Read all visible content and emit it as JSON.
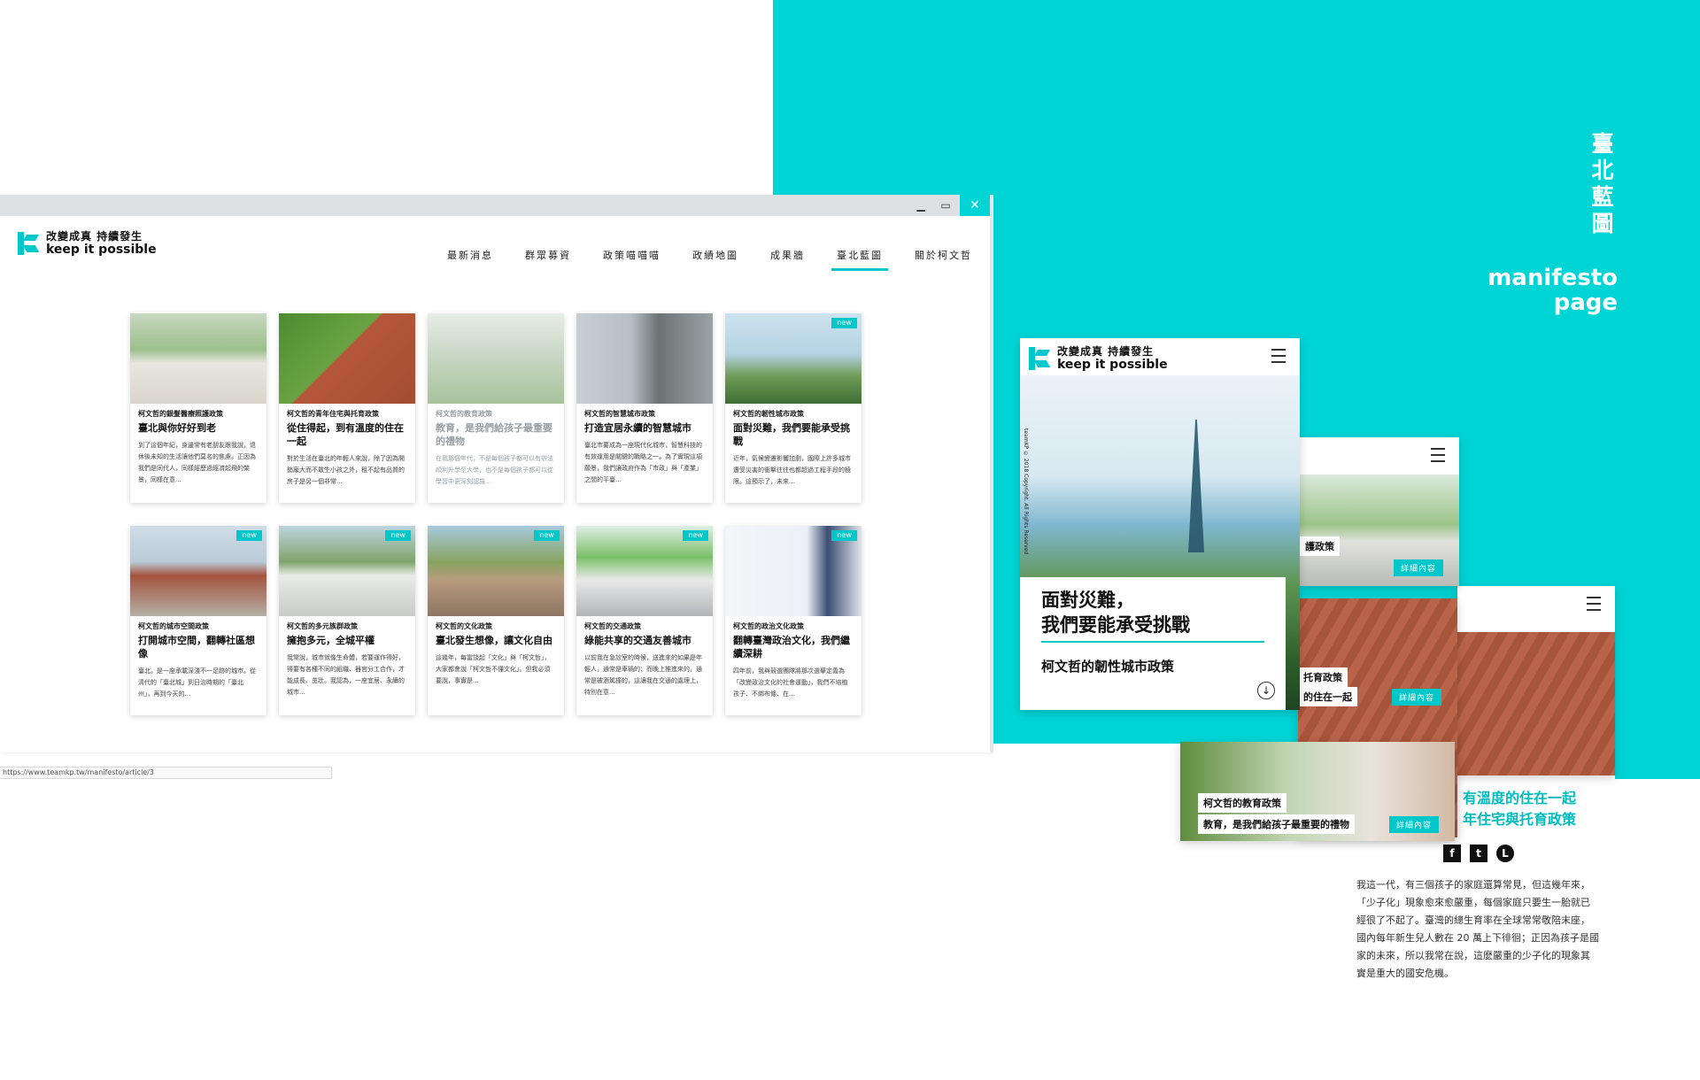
{
  "side_title": "臺北藍圖",
  "manifesto": {
    "line1": "manifesto",
    "line2": "page"
  },
  "logo": {
    "zh": "改變成真 持續發生",
    "en": "keep it possible"
  },
  "nav": [
    "最新消息",
    "群眾募資",
    "政策喵喵喵",
    "政績地圖",
    "成果牆",
    "臺北藍圖",
    "關於柯文哲"
  ],
  "nav_active_index": 5,
  "badge_new": "new",
  "cards": [
    {
      "tag": "柯文哲的銀髮醫療照護政策",
      "title": "臺北與你好好到老",
      "excerpt": "到了這個年紀，身邊常有老朋友跟我說，退休後未知的生活讓他們莫名的焦慮。正因為我們是同代人，同樣經歷過經濟起飛的榮景，同樣在意...",
      "new": false,
      "dim": false
    },
    {
      "tag": "柯文哲的青年住宅與托育政策",
      "title": "從住得起，到有溫度的住在一起",
      "excerpt": "對於生活在臺北的年輕人來說，除了因為開銷龐大而不敢生小孩之外，租不起有品質的房子是另一個非常...",
      "new": false,
      "dim": false
    },
    {
      "tag": "柯文哲的教育政策",
      "title": "教育，是我們給孩子最重要的禮物",
      "excerpt": "在我那個年代，不是每個孩子都可以有辦法順利升學至大學，也不是每個孩子都可以從學習中更深刻認識...",
      "new": false,
      "dim": true
    },
    {
      "tag": "柯文哲的智慧城市政策",
      "title": "打造宜居永續的智慧城市",
      "excerpt": "臺北市要成為一座現代化城市，智慧科技的有效運用是關鍵的戰略之一。為了實現這項願景，我們讓政府作為「市政」與「產業」之間的平臺...",
      "new": false,
      "dim": false
    },
    {
      "tag": "柯文哲的韌性城市政策",
      "title": "面對災難，我們要能承受挑戰",
      "excerpt": "近年，氣候變遷影響加劇，國際上許多城市遭受災害的衝擊往往也都超過工程手段的極限。這預示了，未來...",
      "new": true,
      "dim": false
    },
    {
      "tag": "柯文哲的城市空間政策",
      "title": "打開城市空間，翻轉社區想像",
      "excerpt": "臺北，是一座承載深淺不一足跡的城市。從清代的「臺北城」到日治時期的「臺北州」，再到今天的...",
      "new": true,
      "dim": false
    },
    {
      "tag": "柯文哲的多元族群政策",
      "title": "擁抱多元，全城平權",
      "excerpt": "我常說，城市就像生命體，若要運作得好，得要有各種不同的組織、器官分工合作，才能成長、茁壯。我認為，一座宜居、永續的城市...",
      "new": true,
      "dim": false
    },
    {
      "tag": "柯文哲的文化政策",
      "title": "臺北發生想像，讓文化自由",
      "excerpt": "這幾年，每當談起「文化」與「柯文哲」，大家都會說「柯文哲不懂文化」。但我必須要說，事實是...",
      "new": true,
      "dim": false
    },
    {
      "tag": "柯文哲的交通政策",
      "title": "綠能共享的交通友善城市",
      "excerpt": "以前我在急診室的時候，送進來的如果是年輕人，通常是車禍的；而晚上推進來的，通常是被酒駕撞的，這讓我在交通的處理上，特別在意...",
      "new": true,
      "dim": false
    },
    {
      "tag": "柯文哲的政治文化政策",
      "title": "翻轉臺灣政治文化，我們繼續深耕",
      "excerpt": "四年前，我與競選團隊將那次選舉定義為「改變政治文化的社會運動」，我們不培植孩子、不綁布條、在...",
      "new": true,
      "dim": false
    }
  ],
  "status_url": "https://www.teamkp.tw/manifesto/article/3",
  "mobile": {
    "copyright": "teamKP © 2018 Copyright. All Rights Reserved",
    "hero_title_1": "面對災難，",
    "hero_title_2": "我們要能承受挑戰",
    "hero_sub": "柯文哲的韌性城市政策",
    "detail_label": "詳細內容",
    "cap_b": "護政策",
    "cap_d_1": "托育政策",
    "cap_d_2": "的住在一起",
    "cap_e_1": "柯文哲的教育政策",
    "cap_e_2": "教育，是我們給孩子最重要的禮物",
    "c_title_1": "有溫度的住在一起",
    "c_title_2": "年住宅與托育政策",
    "social": [
      "f",
      "t",
      "L"
    ],
    "body": "我這一代，有三個孩子的家庭還算常見，但這幾年來，「少子化」現象愈來愈嚴重，每個家庭只要生一胎就已經很了不起了。臺灣的總生育率在全球常常敬陪末座，國內每年新生兒人數在 20 萬上下徘徊；正因為孩子是國家的未來，所以我常在說，這麼嚴重的少子化的現象其實是重大的國安危機。"
  },
  "colors": {
    "accent": "#00d4d5",
    "accent_dark": "#00c7c9"
  }
}
